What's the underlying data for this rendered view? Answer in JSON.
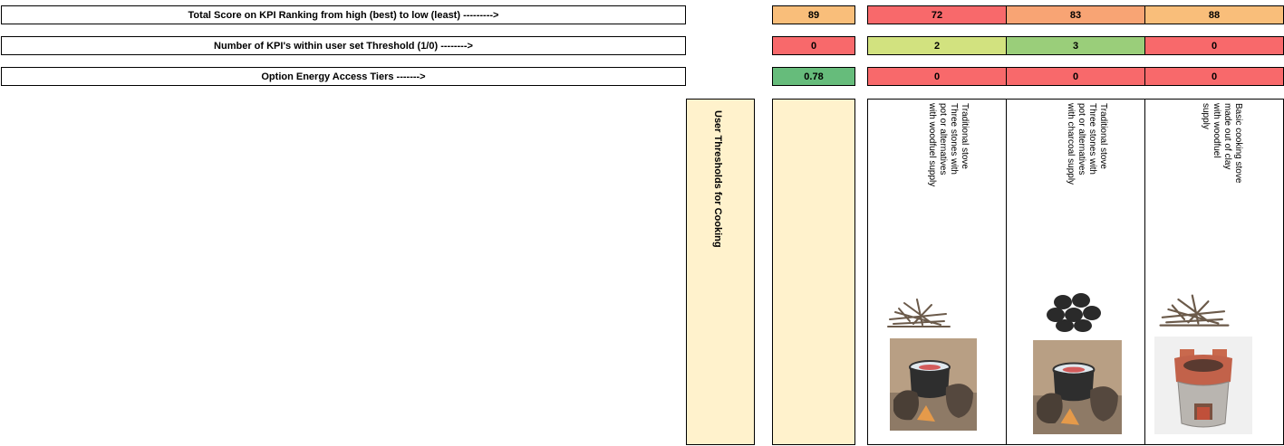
{
  "rows": {
    "total_score": {
      "label": "Total Score on KPI Ranking from high (best) to low (least) --------->",
      "threshold_value": "89",
      "options": [
        "72",
        "83",
        "88"
      ]
    },
    "kpi_within_threshold": {
      "label": "Number of KPI's within user set Threshold (1/0) -------->",
      "threshold_value": "0",
      "options": [
        "2",
        "3",
        "0"
      ]
    },
    "energy_access_tiers": {
      "label": "Option Energy Access Tiers ------->",
      "threshold_value": "0.78",
      "options": [
        "0",
        "0",
        "0"
      ]
    }
  },
  "user_thresholds_label": "User Thresholds for Cooking",
  "options": [
    {
      "description": "Traditional stove\nThree stones with\npot or alternatives\nwith woodfuel supply",
      "fuel_icon": "firewood-icon",
      "stove_icon": "three-stone-stove-icon"
    },
    {
      "description": "Traditional stove\nThree stones with\npot or alternatives\nwith charcoal supply",
      "fuel_icon": "charcoal-icon",
      "stove_icon": "three-stone-stove-icon"
    },
    {
      "description": "Basic cooking stove\nmade out of clay\nwith woodfuel\nsupply",
      "fuel_icon": "firewood-icon",
      "stove_icon": "clay-stove-icon"
    }
  ],
  "colors": {
    "orange_light": "#F9BE7A",
    "orange": "#F8A474",
    "red": "#F8696B",
    "yellow_green": "#D2E27F",
    "green": "#9ACE7A",
    "green_strong": "#66BC7B",
    "cream": "#FFF2CC"
  }
}
